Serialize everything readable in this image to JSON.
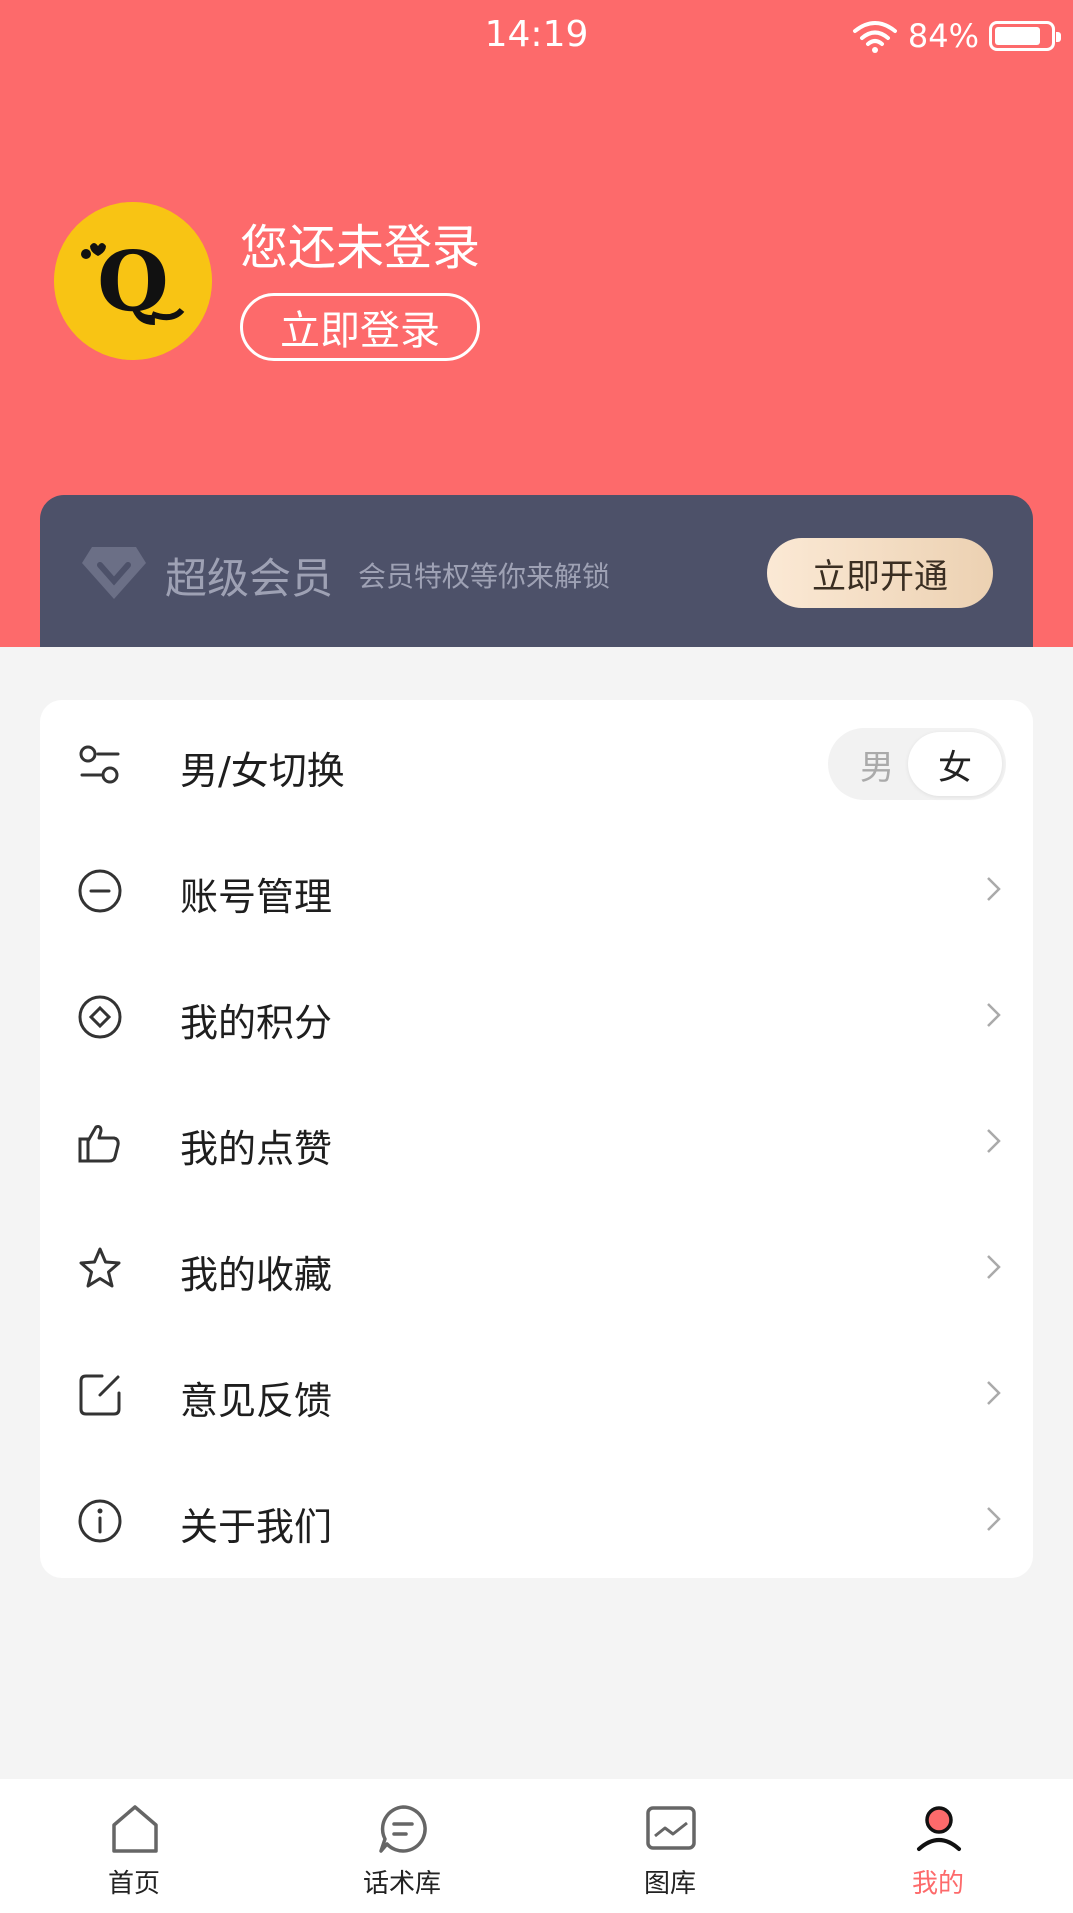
{
  "status_bar": {
    "time": "14:19",
    "battery_text": "84%",
    "battery_level": 0.84,
    "icons": [
      "wifi-icon",
      "battery-icon"
    ]
  },
  "profile": {
    "title": "您还未登录",
    "login_button": "立即登录",
    "avatar_icon": "q-bird-logo"
  },
  "vip": {
    "title": "超级会员",
    "subtitle": "会员特权等你来解锁",
    "button": "立即开通",
    "icon": "diamond-icon"
  },
  "menu": {
    "gender_switch": {
      "label": "男/女切换",
      "male": "男",
      "female": "女",
      "selected": "女",
      "icon": "toggle-sliders-icon"
    },
    "items": [
      {
        "label": "账号管理",
        "icon": "account-icon"
      },
      {
        "label": "我的积分",
        "icon": "points-icon"
      },
      {
        "label": "我的点赞",
        "icon": "thumbs-up-icon"
      },
      {
        "label": "我的收藏",
        "icon": "star-icon"
      },
      {
        "label": "意见反馈",
        "icon": "feedback-icon"
      },
      {
        "label": "关于我们",
        "icon": "info-icon"
      }
    ]
  },
  "tabbar": {
    "tabs": [
      {
        "label": "首页",
        "icon": "home-icon"
      },
      {
        "label": "话术库",
        "icon": "chat-icon"
      },
      {
        "label": "图库",
        "icon": "gallery-icon"
      },
      {
        "label": "我的",
        "icon": "user-icon",
        "active": true
      }
    ]
  },
  "colors": {
    "brand": "#fd6a6b",
    "vip_bg": "#4d5169",
    "vip_text": "#9ea1b4",
    "vip_button": "#f3dcc2",
    "avatar_bg": "#f8c414"
  }
}
